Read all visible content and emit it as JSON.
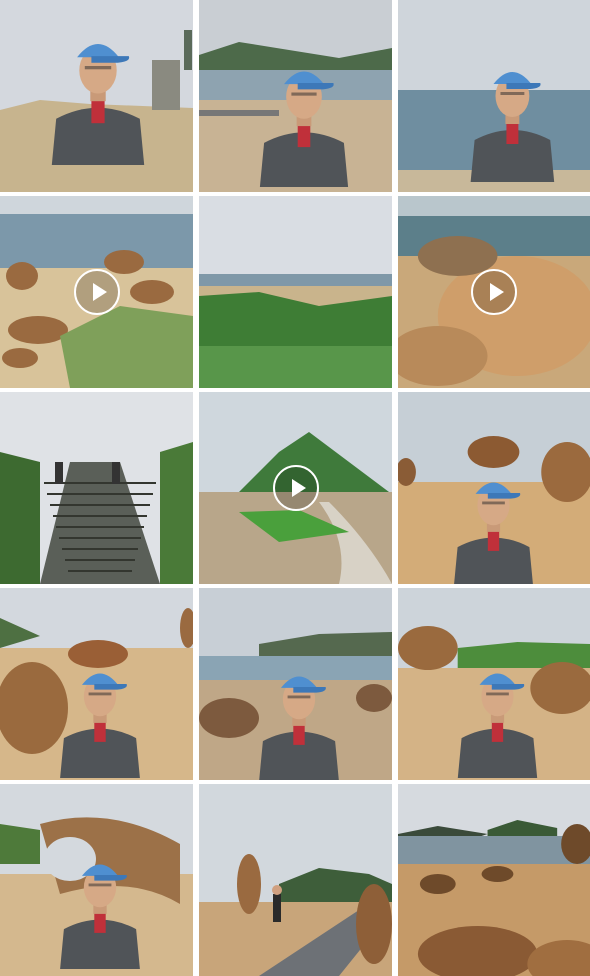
{
  "gallery": {
    "columns": 3,
    "tiles": [
      {
        "id": 1,
        "type": "photo",
        "scene": "selfie-statue"
      },
      {
        "id": 2,
        "type": "photo",
        "scene": "selfie-boardwalk"
      },
      {
        "id": 3,
        "type": "photo",
        "scene": "selfie-sea"
      },
      {
        "id": 4,
        "type": "video",
        "scene": "mushroom-rocks-coast"
      },
      {
        "id": 5,
        "type": "photo",
        "scene": "grassland-coast"
      },
      {
        "id": 6,
        "type": "video",
        "scene": "honeycomb-rock"
      },
      {
        "id": 7,
        "type": "photo",
        "scene": "stairs"
      },
      {
        "id": 8,
        "type": "video",
        "scene": "headland-path"
      },
      {
        "id": 9,
        "type": "photo",
        "scene": "selfie-rock-pillars"
      },
      {
        "id": 10,
        "type": "photo",
        "scene": "selfie-honeycomb"
      },
      {
        "id": 11,
        "type": "photo",
        "scene": "selfie-bridge-cove"
      },
      {
        "id": 12,
        "type": "photo",
        "scene": "selfie-green-cliff"
      },
      {
        "id": 13,
        "type": "photo",
        "scene": "selfie-rock-arch"
      },
      {
        "id": 14,
        "type": "photo",
        "scene": "walkway-walker"
      },
      {
        "id": 15,
        "type": "photo",
        "scene": "rocky-shore"
      }
    ]
  },
  "colors": {
    "sky": "#d4d8de",
    "sea": "#7f98a8",
    "sand": "#d8b888",
    "rock": "#9a6a40",
    "grass": "#4f8a3c",
    "cap": "#4f8fd0",
    "jacket": "#505458"
  },
  "icons": {
    "video_badge": "play-circle-icon"
  }
}
